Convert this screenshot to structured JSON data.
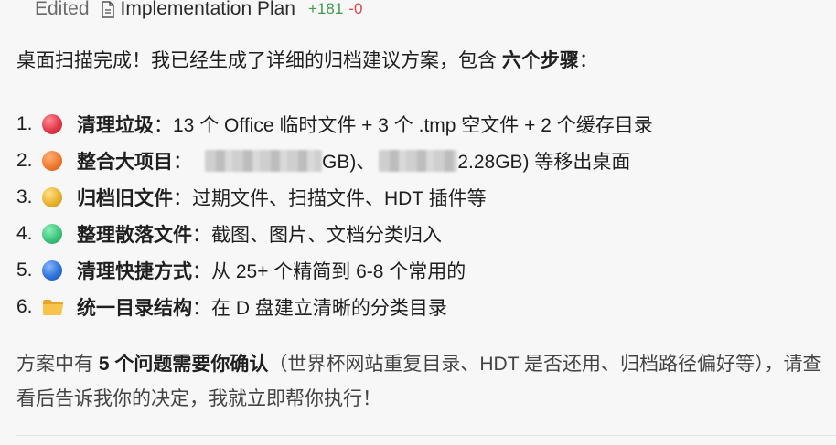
{
  "header": {
    "edited_label": "Edited",
    "doc_icon": "document-icon",
    "plan_name": "Implementation Plan",
    "additions": "+181",
    "deletions": "-0"
  },
  "intro": {
    "prefix": "桌面扫描完成！我已经生成了详细的归档建议方案，包含 ",
    "bold": "六个步骤",
    "suffix": "："
  },
  "steps": [
    {
      "num": "1.",
      "icon": "red-circle-icon",
      "color": "#e03a4a",
      "title": "清理垃圾",
      "text": "：13 个 Office 临时文件 + 3 个 .tmp 空文件 + 2 个缓存目录"
    },
    {
      "num": "2.",
      "icon": "orange-circle-icon",
      "color": "#f07a2f",
      "title": "整合大项目",
      "text_a": "：",
      "text_b": "GB)、",
      "text_c": "2.28GB) 等移出桌面"
    },
    {
      "num": "3.",
      "icon": "yellow-circle-icon",
      "color": "#e9b22f",
      "title": "归档旧文件",
      "text": "：过期文件、扫描文件、HDT 插件等"
    },
    {
      "num": "4.",
      "icon": "green-circle-icon",
      "color": "#3cc47c",
      "title": "整理散落文件",
      "text": "：截图、图片、文档分类归入"
    },
    {
      "num": "5.",
      "icon": "blue-circle-icon",
      "color": "#2f73d9",
      "title": "清理快捷方式",
      "text": "：从 25+ 个精简到 6-8 个常用的"
    },
    {
      "num": "6.",
      "icon": "folder-icon",
      "color": "#f2b53a",
      "title": "统一目录结构",
      "text": "：在 D 盘建立清晰的分类目录"
    }
  ],
  "closing": {
    "prefix": "方案中有 ",
    "bold": "5 个问题需要你确认",
    "suffix": "（世界杯网站重复目录、HDT 是否还用、归档路径偏好等），请查看后告诉我你的决定，我就立即帮你执行！"
  }
}
